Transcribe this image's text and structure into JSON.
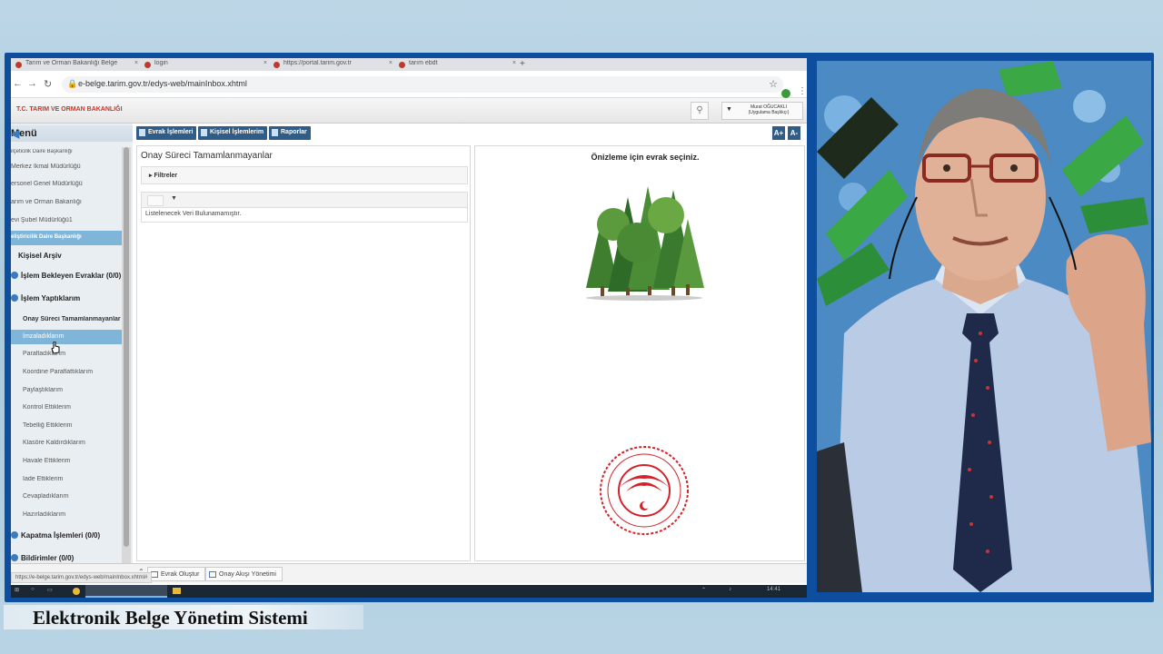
{
  "browser": {
    "tabs": [
      {
        "label": "Tarım ve Orman Bakanlığı Belge"
      },
      {
        "label": "login"
      },
      {
        "label": "https://portal.tarim.gov.tr"
      },
      {
        "label": "tarım ebdt"
      }
    ],
    "url": "e-belge.tarim.gov.tr/edys-web/mainInbox.xhtml"
  },
  "header": {
    "ministry": "T.C. TARIM VE ORMAN BAKANLIĞI",
    "user_name": "Murat OĞUCAKLI",
    "user_role": "(Uygulama Başlıkçı)"
  },
  "toolbar": {
    "evrak": "Evrak İşlemleri",
    "kisisel": "Kişisel İşlemlerim",
    "raporlar": "Raporlar",
    "zoom_in": "A+",
    "zoom_out": "A-"
  },
  "sidebar": {
    "title": "Menü",
    "units": [
      "ilçeticilik Daire Başkanlığı",
      "Merkez İkmal Müdürlüğü",
      "ersonel Genel Müdürlüğü",
      "arım ve Orman Bakanlığı",
      "evi Şubel Müdürlüğü1",
      "eliştiricilik Daire Başkanlığı"
    ],
    "kisisel_arsiv": "Kişisel Arşiv",
    "islem_bekleyen": "İşlem Bekleyen Evraklar (0/0)",
    "islem_yaptiklarim": "İşlem Yaptıklarım",
    "sub_items": [
      "Onay Süreci Tamamlanmayanlar",
      "İmzaladıklarım",
      "Parafladıklarım",
      "Koordine Paraflattıklarım",
      "Paylaştıklarım",
      "Kontrol Ettiklerim",
      "Tebelliğ Ettiklerim",
      "Klasöre Kaldırdıklarım",
      "Havale Ettiklerim",
      "İade Ettiklerim",
      "Cevapladıklarım",
      "Hazırladıklarım"
    ],
    "kapatma": "Kapatma İşlemleri (0/0)",
    "bildirimler": "Bildirimler (0/0)"
  },
  "center": {
    "title": "Onay Süreci Tamamlanmayanlar",
    "filters": "Filtreler",
    "empty": "Listelenecek Veri Bulunamamıştır."
  },
  "preview": {
    "message": "Önizleme için evrak seçiniz."
  },
  "bottom": {
    "tab1": "Evrak Oluştur",
    "tab2": "Onay Akışı Yönetimi",
    "status_url": "https://e-belge.tarim.gov.tr/edys-web/mainInbox.xhtml#",
    "clock": "14:41"
  },
  "caption": "Elektronik Belge Yönetim Sistemi",
  "colors": {
    "frame": "#0d4f9e",
    "toolbar_button": "#2f5d87",
    "sidebar_highlight": "#7fb5d8",
    "ministry_red": "#c0392b"
  }
}
